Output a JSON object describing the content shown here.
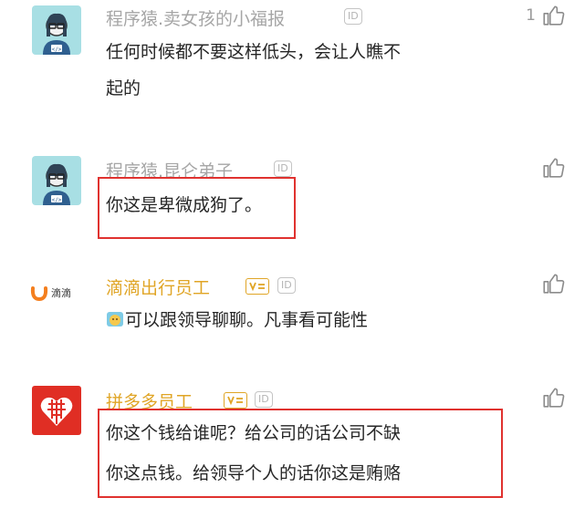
{
  "comments": [
    {
      "username": "程序猿.卖女孩的小福报",
      "badge": "ID",
      "lines": [
        "任何时候都不要这样低头，会让人瞧不",
        "起的"
      ],
      "likes": "1"
    },
    {
      "username": "程序猿.昆仑弟子",
      "badge": "ID",
      "lines": [
        "你这是卑微成狗了。"
      ]
    },
    {
      "username": "滴滴出行员工",
      "badge": "ID",
      "avatar_text": "滴滴",
      "lines": [
        "可以跟领导聊聊。凡事看可能性"
      ]
    },
    {
      "username": "拼多多员工",
      "badge": "ID",
      "lines": [
        "你这个钱给谁呢？给公司的话公司不缺",
        "你这点钱。给领导个人的话你这是贿赂"
      ]
    }
  ],
  "colors": {
    "accent_gold": "#e0a526",
    "highlight_red": "#e0322f",
    "pdd_red": "#e02e24",
    "didi_orange": "#f47f1f"
  },
  "icons": [
    "like-icon",
    "id-badge-icon",
    "verified-badge-icon",
    "emoji-icon"
  ]
}
